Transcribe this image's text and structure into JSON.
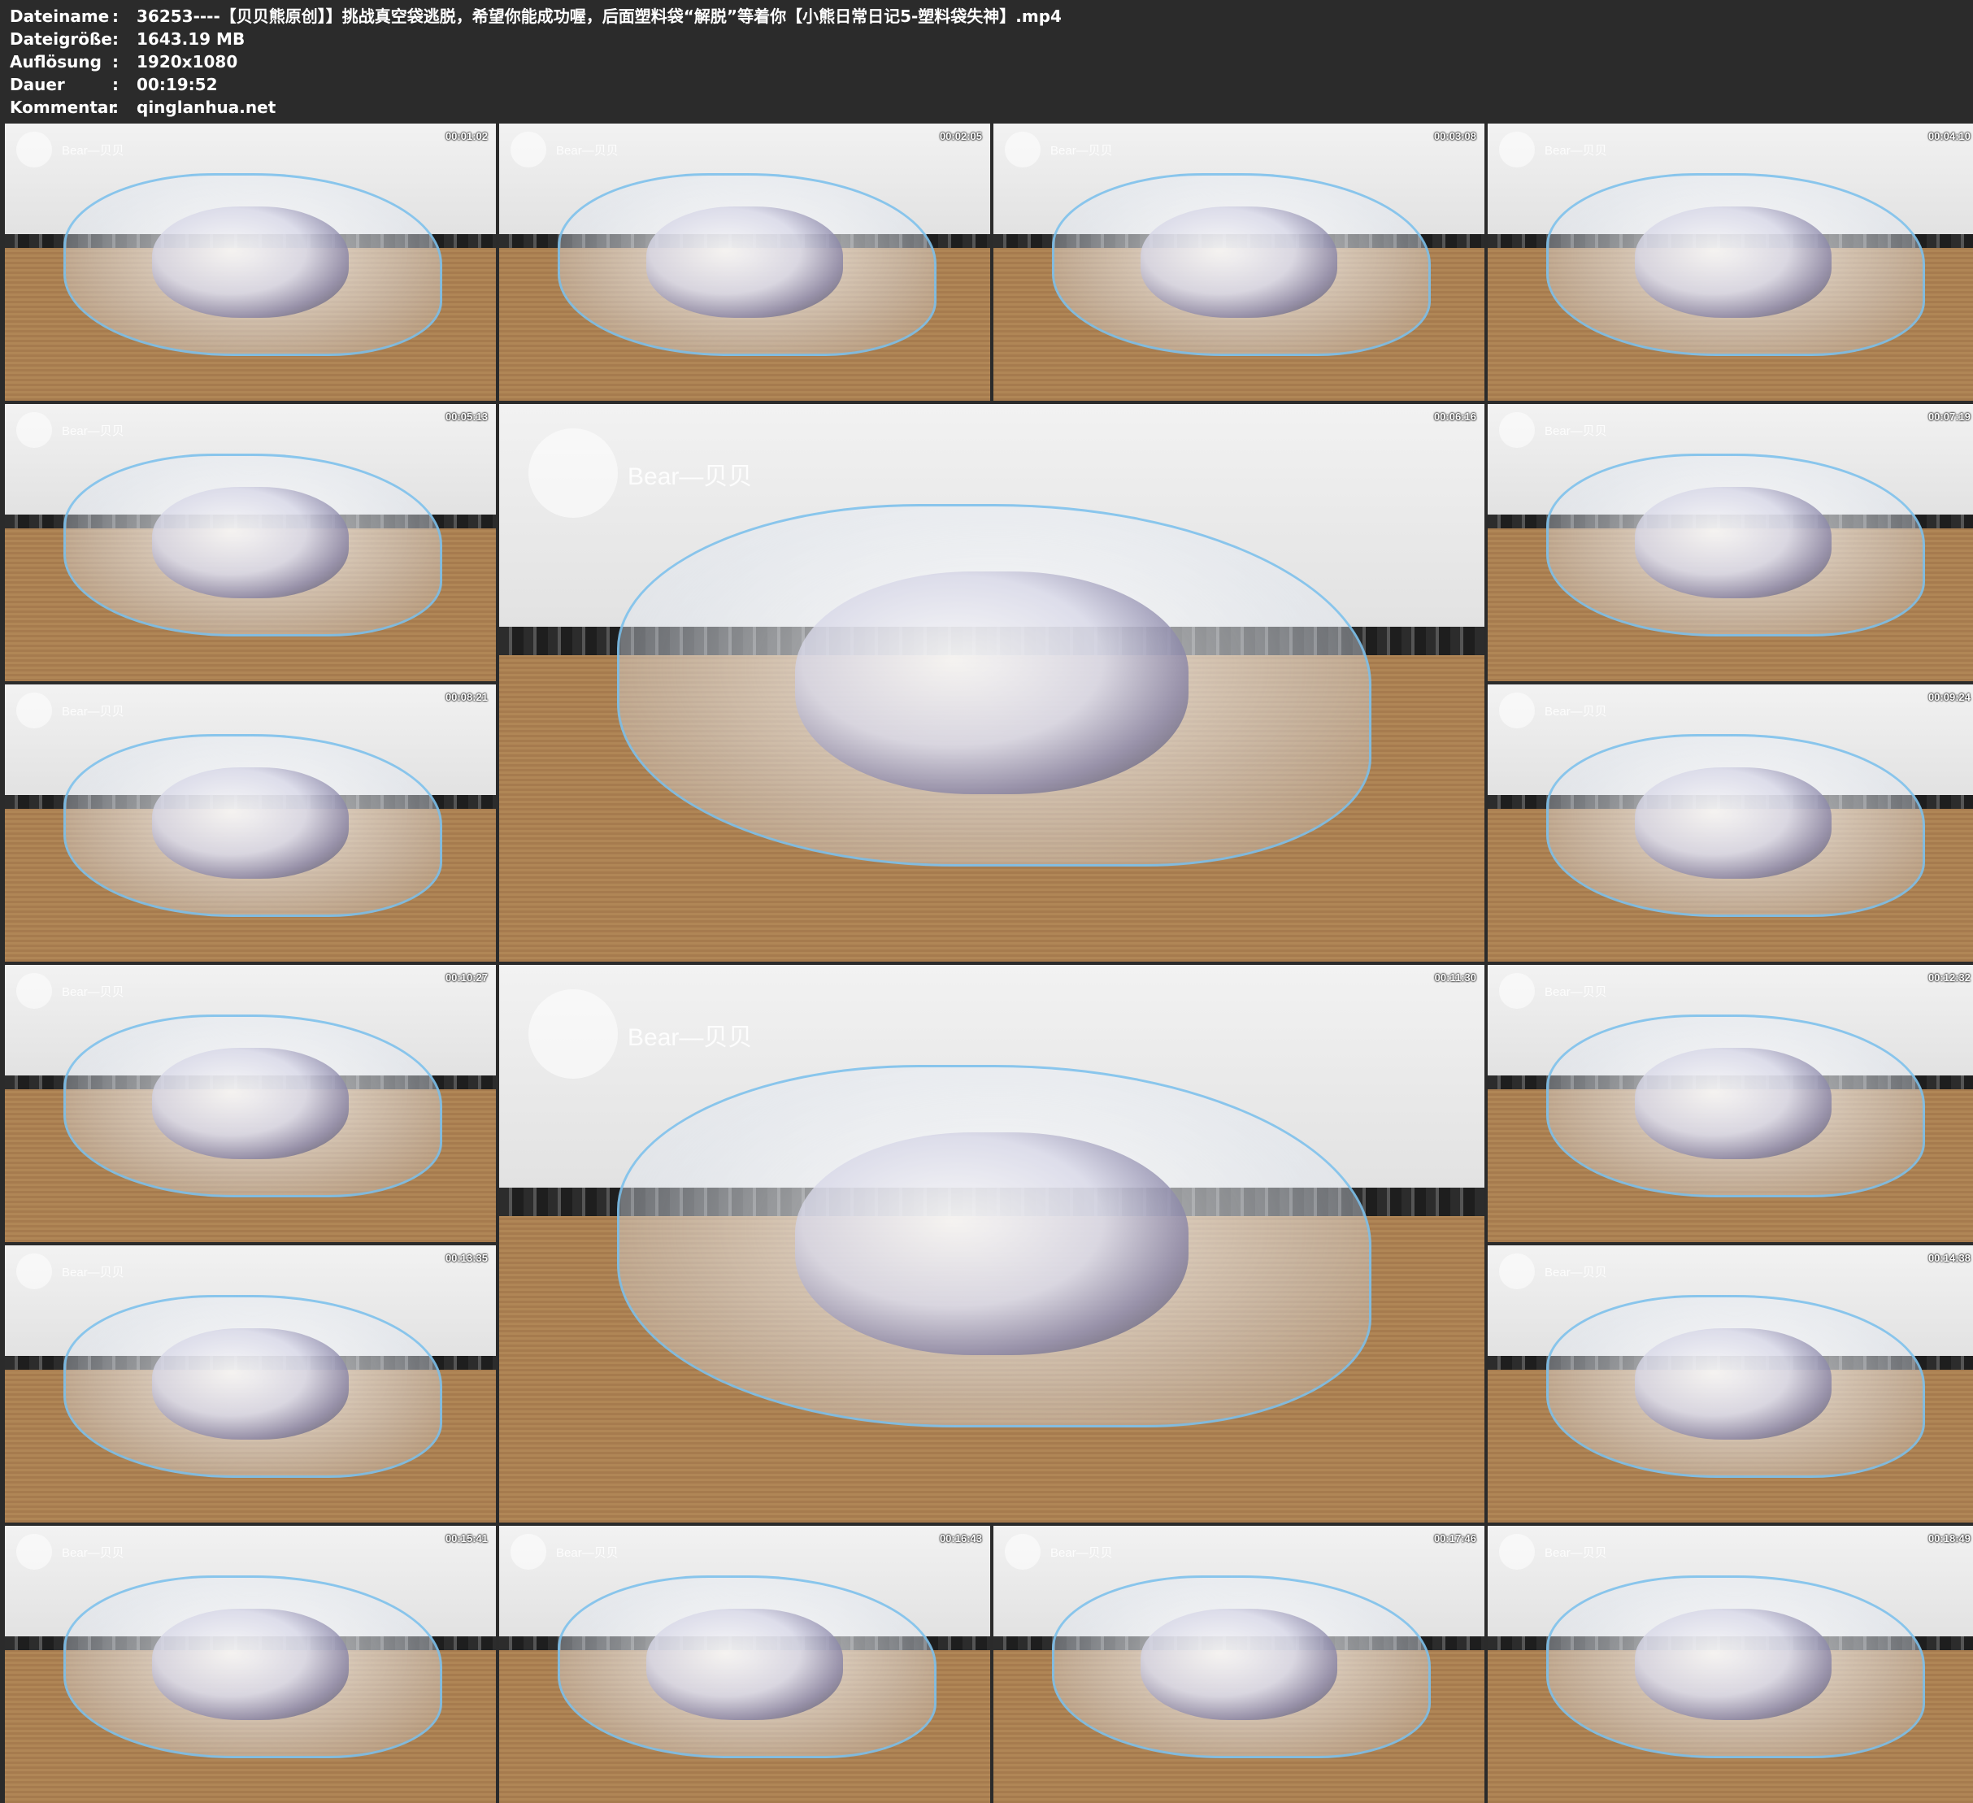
{
  "meta": {
    "filename_label": "Dateiname",
    "filename_value": "36253----【贝贝熊原创】】挑战真空袋逃脱，希望你能成功喔，后面塑料袋“解脱”等着你【小熊日常日记5-塑料袋失神】.mp4",
    "size_label": "Dateigröße",
    "size_value": "1643.19 MB",
    "resolution_label": "Auflösung",
    "resolution_value": "1920x1080",
    "duration_label": "Dauer",
    "duration_value": "00:19:52",
    "comment_label": "Kommentar",
    "comment_value": "qinglanhua.net",
    "separator": ":"
  },
  "watermark": "Bear—贝贝",
  "thumbnails": [
    {
      "timestamp": "00:01:02"
    },
    {
      "timestamp": "00:02:05"
    },
    {
      "timestamp": "00:03:08"
    },
    {
      "timestamp": "00:04:10"
    },
    {
      "timestamp": "00:05:13"
    },
    {
      "timestamp": "00:06:16"
    },
    {
      "timestamp": "00:07:19"
    },
    {
      "timestamp": "00:08:21"
    },
    {
      "timestamp": "00:09:24"
    },
    {
      "timestamp": "00:10:27"
    },
    {
      "timestamp": "00:11:30"
    },
    {
      "timestamp": "00:12:32"
    },
    {
      "timestamp": "00:13:35"
    },
    {
      "timestamp": "00:14:38"
    },
    {
      "timestamp": "00:15:41"
    },
    {
      "timestamp": "00:16:43"
    },
    {
      "timestamp": "00:17:46"
    },
    {
      "timestamp": "00:18:49"
    }
  ]
}
